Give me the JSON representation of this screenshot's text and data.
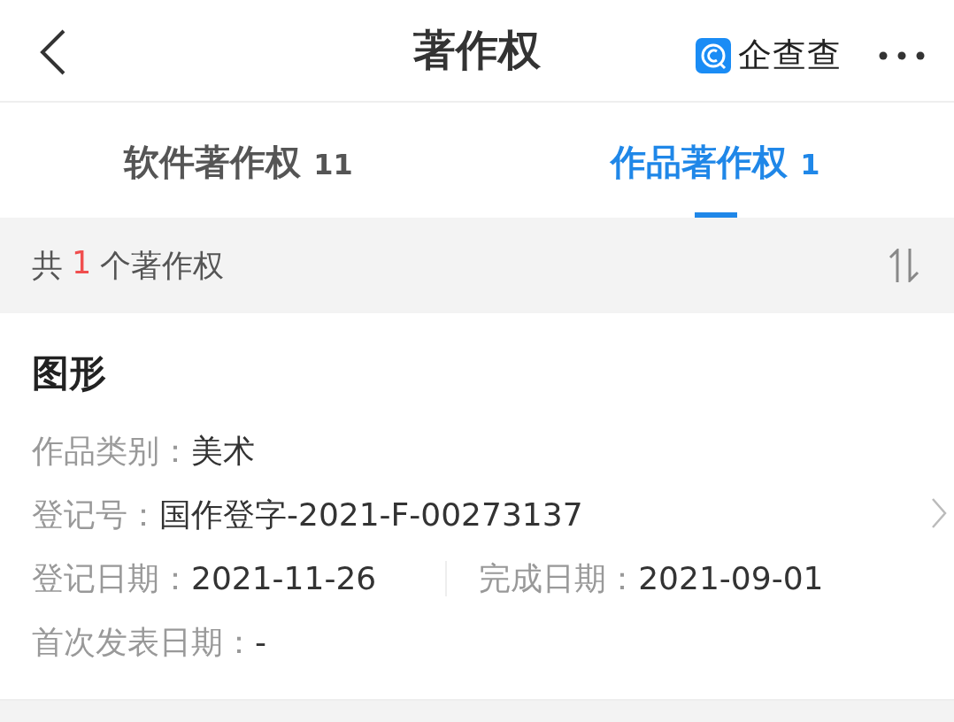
{
  "header": {
    "title": "著作权",
    "logo_text": "企查查"
  },
  "tabs": [
    {
      "label": "软件著作权",
      "count": "11",
      "selected": false
    },
    {
      "label": "作品著作权",
      "count": "1",
      "selected": true
    }
  ],
  "summary": {
    "prefix": "共",
    "count": "1",
    "suffix": "个著作权"
  },
  "card": {
    "title": "图形",
    "rows": [
      {
        "fields": [
          {
            "label": "作品类别：",
            "value": "美术"
          }
        ]
      },
      {
        "fields": [
          {
            "label": "登记号：",
            "value": "国作登字-2021-F-00273137"
          }
        ]
      },
      {
        "fields": [
          {
            "label": "登记日期：",
            "value": "2021-11-26"
          },
          {
            "label": "完成日期：",
            "value": "2021-09-01"
          }
        ]
      },
      {
        "fields": [
          {
            "label": "首次发表日期：",
            "value": "-"
          }
        ]
      }
    ]
  }
}
